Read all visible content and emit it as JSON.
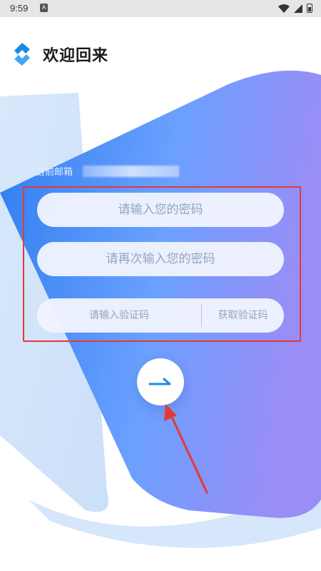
{
  "status_bar": {
    "time": "9:59",
    "notification_icon": "A"
  },
  "header": {
    "title": "欢迎回来",
    "logo_icon": "app-logo-icon"
  },
  "email": {
    "label": "当前邮箱"
  },
  "form": {
    "password_placeholder": "请输入您的密码",
    "confirm_password_placeholder": "请再次输入您的密码",
    "code_placeholder": "请输入验证码",
    "get_code_label": "获取验证码"
  },
  "next_button": {
    "icon": "arrow-right-icon"
  },
  "colors": {
    "primary_blue": "#4a8ef6",
    "accent_purple": "#8e8cf7",
    "highlight_red": "#e53935"
  }
}
